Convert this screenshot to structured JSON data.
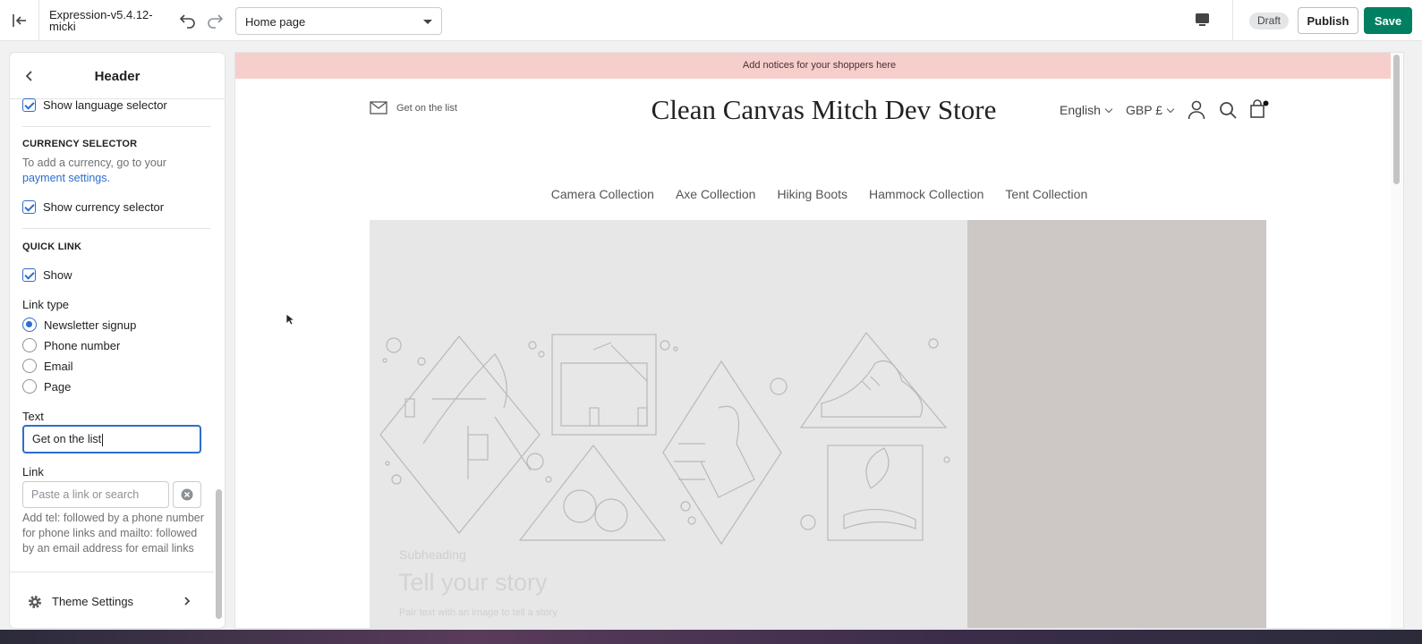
{
  "topbar": {
    "theme_name": "Expression-v5.4.12-micki",
    "page_select": "Home page",
    "draft_badge": "Draft",
    "publish_label": "Publish",
    "save_label": "Save"
  },
  "sidebar": {
    "title": "Header",
    "show_language_selector": "Show language selector",
    "currency_section": "CURRENCY SELECTOR",
    "currency_help_prefix": "To add a currency, go to your",
    "currency_help_link": "payment settings.",
    "show_currency_selector": "Show currency selector",
    "quick_link_section": "QUICK LINK",
    "quick_link_show": "Show",
    "link_type_label": "Link type",
    "link_types": [
      "Newsletter signup",
      "Phone number",
      "Email",
      "Page"
    ],
    "text_label": "Text",
    "text_value": "Get on the list",
    "link_label": "Link",
    "link_placeholder": "Paste a link or search",
    "link_help": "Add tel: followed by a phone number for phone links and mailto: followed by an email address for email links",
    "theme_settings": "Theme Settings"
  },
  "preview": {
    "announcement": "Add notices for your shoppers here",
    "quick_link": "Get on the list",
    "store_title": "Clean Canvas Mitch Dev Store",
    "language": "English",
    "currency": "GBP £",
    "nav": [
      "Camera Collection",
      "Axe Collection",
      "Hiking Boots",
      "Hammock Collection",
      "Tent Collection"
    ],
    "hero_subheading": "Subheading",
    "hero_title": "Tell your story",
    "hero_text": "Pair text with an image to tell a story"
  },
  "colors": {
    "accent": "#2c6ecb",
    "save": "#008060",
    "announcement_bg": "#f6cfcd"
  }
}
